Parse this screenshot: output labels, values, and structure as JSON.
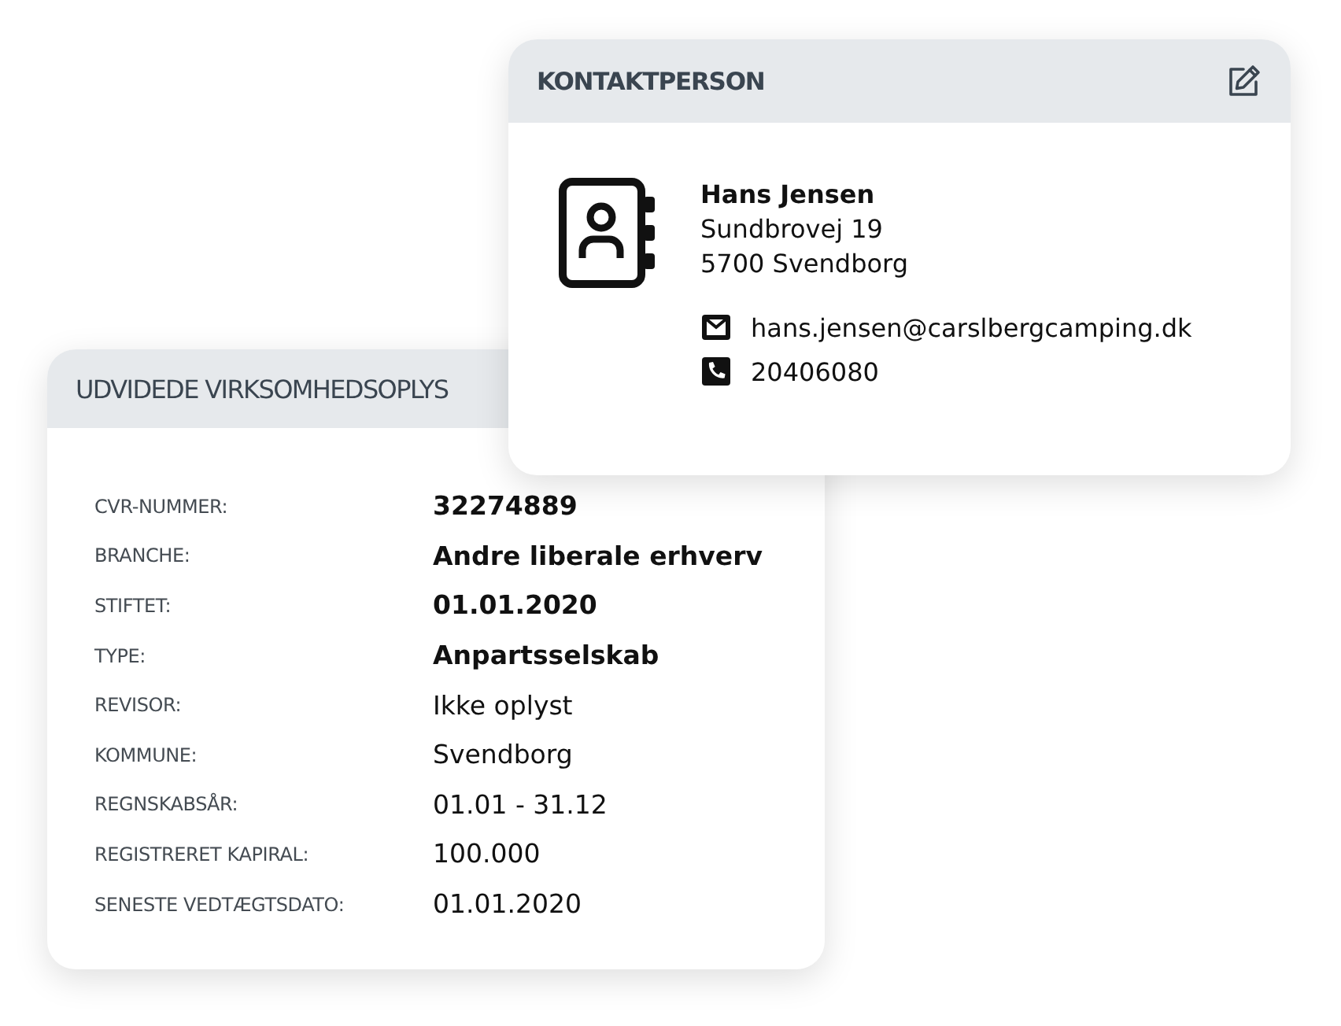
{
  "company_card": {
    "title": "UDVIDEDE VIRKSOMHEDSOPLYS",
    "rows": [
      {
        "label": "CVR-NUMMER:",
        "value": "32274889",
        "emphasis": true
      },
      {
        "label": "BRANCHE:",
        "value": "Andre liberale erhverv",
        "emphasis": true
      },
      {
        "label": "STIFTET:",
        "value": "01.01.2020",
        "emphasis": true
      },
      {
        "label": "TYPE:",
        "value": "Anpartsselskab",
        "emphasis": true
      },
      {
        "label": "REVISOR:",
        "value": "Ikke oplyst",
        "emphasis": false
      },
      {
        "label": "KOMMUNE:",
        "value": "Svendborg",
        "emphasis": false
      },
      {
        "label": "REGNSKABSÅR:",
        "value": "01.01 - 31.12",
        "emphasis": false
      },
      {
        "label": "REGISTRERET KAPIRAL:",
        "value": "100.000",
        "emphasis": false
      },
      {
        "label": "SENESTE VEDTÆGTSDATO:",
        "value": "01.01.2020",
        "emphasis": false
      }
    ]
  },
  "contact_card": {
    "title": "KONTAKTPERSON",
    "name": "Hans Jensen",
    "address": [
      "Sundbrovej 19",
      "5700 Svendborg"
    ],
    "contacts": [
      {
        "kind": "email",
        "text": "hans.jensen@carslbergcamping.dk"
      },
      {
        "kind": "phone",
        "text": "20406080"
      }
    ]
  }
}
